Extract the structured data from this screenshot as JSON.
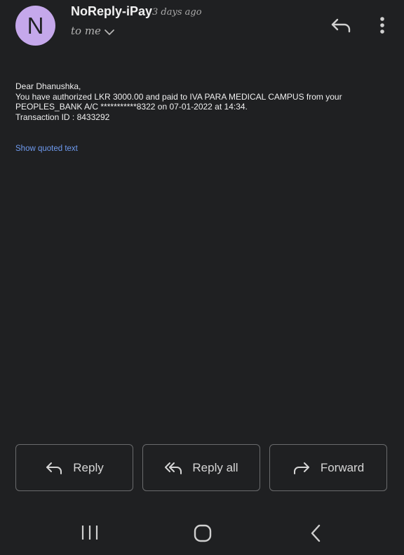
{
  "header": {
    "avatar_letter": "N",
    "sender": "NoReply-iPay",
    "time": "3 days ago",
    "recipient": "to me",
    "icons": [
      "chevron-down-icon",
      "reply-icon",
      "more-vert-icon"
    ]
  },
  "message": {
    "lines": [
      "Dear Dhanushka,",
      "You have authorized LKR 3000.00 and paid to IVA PARA MEDICAL CAMPUS from your",
      "PEOPLES_BANK A/C ***********8322 on 07-01-2022 at 14:34.",
      "Transaction ID : 8433292"
    ],
    "show_quoted_text": "Show quoted text"
  },
  "actions": {
    "reply_label": "Reply",
    "reply_all_label": "Reply all",
    "forward_label": "Forward"
  },
  "navbar": {
    "icons": [
      "recent-apps-icon",
      "home-icon",
      "back-icon"
    ]
  },
  "colors": {
    "background": "#1f2022",
    "avatar": "#c5a8eb",
    "link": "#6f9bf0",
    "button_border": "#6a6b6d"
  }
}
